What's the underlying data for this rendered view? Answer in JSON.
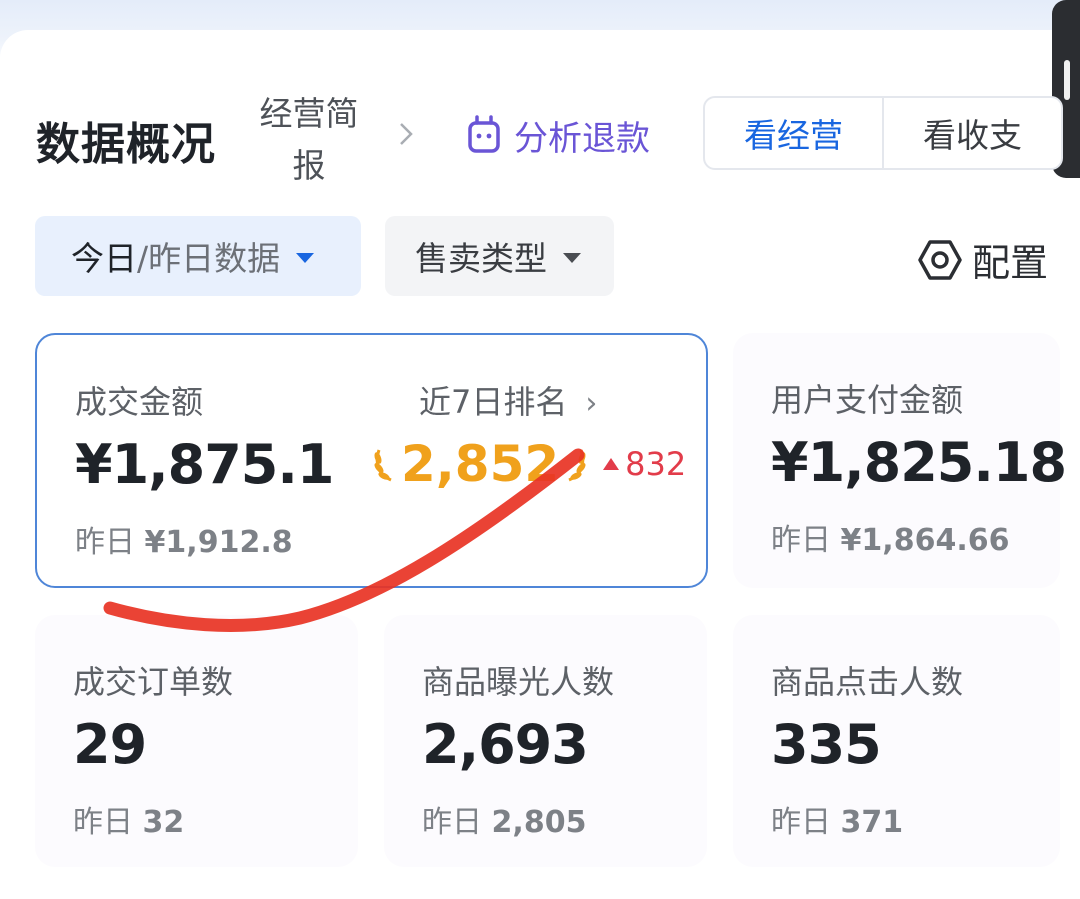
{
  "header": {
    "title": "数据概况",
    "brief_line1": "经营简",
    "brief_line2": "报",
    "refund_label": "分析退款",
    "toggle": [
      {
        "label": "看经营",
        "active": true
      },
      {
        "label": "看收支",
        "active": false
      }
    ]
  },
  "filters": {
    "date_label_active": "今日",
    "date_label_rest": "/昨日数据",
    "type_label": "售卖类型",
    "config_label": "配置"
  },
  "metrics": {
    "gmv": {
      "title": "成交金额",
      "value": "¥1,875.1",
      "prev_prefix": "昨日 ",
      "prev_value": "¥1,912.8",
      "rank_label": "近7日排名",
      "rank_value": "2,852",
      "rank_change": "832"
    },
    "user_pay": {
      "title": "用户支付金额",
      "value": "¥1,825.18",
      "prev_prefix": "昨日 ",
      "prev_value": "¥1,864.66"
    },
    "orders": {
      "title": "成交订单数",
      "value": "29",
      "prev_prefix": "昨日 ",
      "prev_value": "32"
    },
    "impressions": {
      "title": "商品曝光人数",
      "value": "2,693",
      "prev_prefix": "昨日 ",
      "prev_value": "2,805"
    },
    "clicks": {
      "title": "商品点击人数",
      "value": "335",
      "prev_prefix": "昨日 ",
      "prev_value": "371"
    }
  },
  "colors": {
    "accent": "#1966e0",
    "refund": "#6a55d6",
    "rank": "#f0a11c",
    "up": "#e23c4a",
    "annotation": "#e83324"
  }
}
